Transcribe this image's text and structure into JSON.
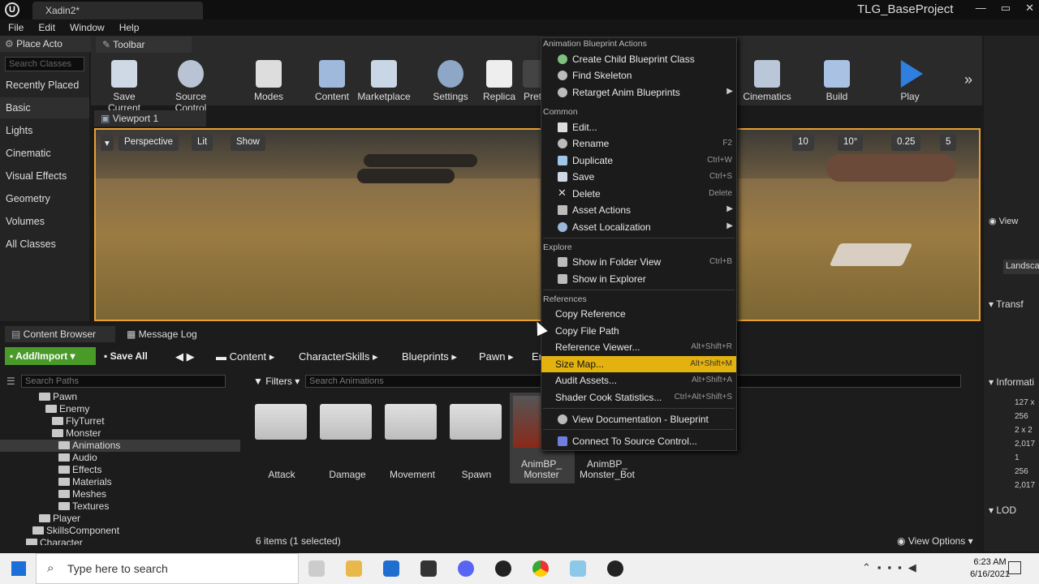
{
  "window": {
    "tab_title": "Xadin2*",
    "project_name": "TLG_BaseProject"
  },
  "menu": [
    "File",
    "Edit",
    "Window",
    "Help"
  ],
  "place_actors": {
    "tab_label": "Place Acto",
    "search_placeholder": "Search Classes",
    "categories": [
      "Recently Placed",
      "Basic",
      "Lights",
      "Cinematic",
      "Visual Effects",
      "Geometry",
      "Volumes",
      "All Classes"
    ]
  },
  "toolbar": {
    "tab_label": "Toolbar",
    "buttons": [
      "Save Current",
      "Source Control",
      "Modes",
      "Content",
      "Marketplace",
      "Settings",
      "Replica",
      "Pret",
      "Cinematics",
      "Build",
      "Play"
    ]
  },
  "viewport": {
    "tab_label": "Viewport 1",
    "perspective": "Perspective",
    "lit": "Lit",
    "show": "Show",
    "grid_snap": "10",
    "rot_snap": "10°",
    "scale_snap": "0.25",
    "cam_speed": "5"
  },
  "context_menu": {
    "sections": [
      {
        "header": "Animation Blueprint Actions",
        "items": [
          {
            "label": "Create Child Blueprint Class",
            "shortcut": "",
            "icon": "child-blueprint-icon"
          },
          {
            "label": "Find Skeleton",
            "shortcut": "",
            "icon": "skeleton-icon"
          },
          {
            "label": "Retarget Anim Blueprints",
            "shortcut": "",
            "icon": "retarget-icon",
            "submenu": true
          }
        ]
      },
      {
        "header": "Common",
        "items": [
          {
            "label": "Edit...",
            "shortcut": "",
            "icon": "edit-icon"
          },
          {
            "label": "Rename",
            "shortcut": "F2",
            "icon": "rename-icon"
          },
          {
            "label": "Duplicate",
            "shortcut": "Ctrl+W",
            "icon": "duplicate-icon"
          },
          {
            "label": "Save",
            "shortcut": "Ctrl+S",
            "icon": "save-icon"
          },
          {
            "label": "Delete",
            "shortcut": "Delete",
            "icon": "delete-icon"
          },
          {
            "label": "Asset Actions",
            "shortcut": "",
            "icon": "wrench-icon",
            "submenu": true
          },
          {
            "label": "Asset Localization",
            "shortcut": "",
            "icon": "globe-icon",
            "submenu": true
          }
        ]
      },
      {
        "header": "Explore",
        "items": [
          {
            "label": "Show in Folder View",
            "shortcut": "Ctrl+B",
            "icon": "folder-view-icon"
          },
          {
            "label": "Show in Explorer",
            "shortcut": "",
            "icon": "explorer-icon"
          }
        ]
      },
      {
        "header": "References",
        "items": [
          {
            "label": "Copy Reference",
            "shortcut": ""
          },
          {
            "label": "Copy File Path",
            "shortcut": ""
          },
          {
            "label": "Reference Viewer...",
            "shortcut": "Alt+Shift+R"
          },
          {
            "label": "Size Map...",
            "shortcut": "Alt+Shift+M",
            "highlighted": true
          },
          {
            "label": "Audit Assets...",
            "shortcut": "Alt+Shift+A"
          },
          {
            "label": "Shader Cook Statistics...",
            "shortcut": "Ctrl+Alt+Shift+S"
          }
        ]
      }
    ],
    "view_documentation": "View Documentation - Blueprint",
    "connect_source_control": "Connect To Source Control..."
  },
  "content_browser": {
    "tab_label": "Content Browser",
    "message_log_tab": "Message Log",
    "add_import": "Add/Import",
    "save_all": "Save All",
    "breadcrumb": [
      "Content",
      "CharacterSkills",
      "Blueprints",
      "Pawn",
      "En"
    ],
    "search_paths_placeholder": "Search Paths",
    "filters": "Filters",
    "search_assets_placeholder": "Search Animations",
    "tree": [
      {
        "label": "Pawn",
        "indent": 3
      },
      {
        "label": "Enemy",
        "indent": 4
      },
      {
        "label": "FlyTurret",
        "indent": 5
      },
      {
        "label": "Monster",
        "indent": 5
      },
      {
        "label": "Animations",
        "indent": 6,
        "selected": true
      },
      {
        "label": "Audio",
        "indent": 6
      },
      {
        "label": "Effects",
        "indent": 6
      },
      {
        "label": "Materials",
        "indent": 6
      },
      {
        "label": "Meshes",
        "indent": 6
      },
      {
        "label": "Textures",
        "indent": 6
      },
      {
        "label": "Player",
        "indent": 4
      },
      {
        "label": "SkillsComponent",
        "indent": 3
      },
      {
        "label": "Character",
        "indent": 2
      }
    ],
    "assets": [
      "Attack",
      "Damage",
      "Movement",
      "Spawn",
      "AnimBP_\nMonster",
      "AnimBP_\nMonster_Bot"
    ],
    "status": "6 items (1 selected)",
    "view_options": "View Options"
  },
  "right_panel": {
    "view_label": "View",
    "landscape": "Landscap",
    "transform": "Transf",
    "information": "Informati",
    "info_values": [
      "127 x",
      "256",
      "2 x 2",
      "2,017",
      "1",
      "256",
      "2,017"
    ],
    "lod": "LOD"
  },
  "taskbar": {
    "search_placeholder": "Type here to search",
    "time": "6:23 AM",
    "date": "6/16/2021"
  }
}
